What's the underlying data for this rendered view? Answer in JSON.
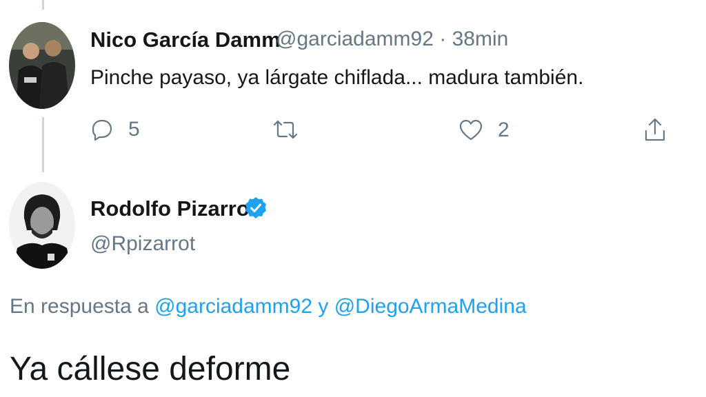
{
  "tweet1": {
    "author_name": "Nico García Damm",
    "author_handle": "@garciadamm92",
    "separator": "·",
    "time": "38min",
    "text": "Pinche payaso, ya lárgate chiflada... madura también.",
    "actions": {
      "reply_icon": "reply-icon",
      "reply_count": "5",
      "retweet_icon": "retweet-icon",
      "like_icon": "heart-icon",
      "like_count": "2",
      "share_icon": "share-icon"
    }
  },
  "tweet2": {
    "author_name": "Rodolfo Pizarro",
    "verified_icon": "verified-badge-icon",
    "author_handle": "@Rpizarrot",
    "reply_prefix": "En respuesta a",
    "reply_mention_1": "@garciadamm92",
    "reply_conjunction": "y",
    "reply_mention_2": "@DiegoArmaMedina",
    "text": "Ya cállese deforme"
  },
  "colors": {
    "text_primary": "#14171a",
    "text_secondary": "#657786",
    "accent": "#1da1f2",
    "thread_line": "#ccd6dd"
  }
}
